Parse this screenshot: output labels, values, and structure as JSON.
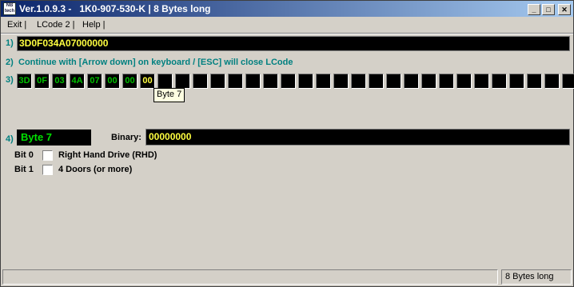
{
  "window": {
    "title": "Ver.1.0.9.3 -   1K0-907-530-K | 8 Bytes long",
    "icon_text": "NB\ntech"
  },
  "menu": [
    {
      "label": "Exit |"
    },
    {
      "label": "LCode 2 |"
    },
    {
      "label": "Help |"
    }
  ],
  "row1": {
    "num": "1)",
    "value": "3D0F034A07000000"
  },
  "row2": {
    "num": "2)",
    "text": "Continue with [Arrow down] on keyboard / [ESC] will close LCode"
  },
  "row3": {
    "num": "3)",
    "cells": [
      "3D",
      "0F",
      "03",
      "4A",
      "07",
      "00",
      "00",
      "00",
      "",
      "",
      "",
      "",
      "",
      "",
      "",
      "",
      "",
      "",
      "",
      "",
      "",
      "",
      "",
      "",
      "",
      "",
      "",
      "",
      "",
      "",
      "",
      ""
    ],
    "active_index": 7,
    "tooltip": "Byte 7"
  },
  "row4": {
    "num": "4)",
    "byte_label": "Byte 7",
    "binary_label": "Binary:",
    "binary_value": "00000000"
  },
  "bits": [
    {
      "bit": "Bit 0",
      "label": "Right Hand Drive (RHD)",
      "checked": false
    },
    {
      "bit": "Bit 1",
      "label": "4 Doors (or more)",
      "checked": false
    }
  ],
  "status": {
    "right": "8 Bytes long"
  },
  "colors": {
    "title_start": "#0a246a",
    "title_end": "#a6caf0",
    "accent": "#008080",
    "hex_text": "#ffff40",
    "cell_text": "#00c000"
  }
}
